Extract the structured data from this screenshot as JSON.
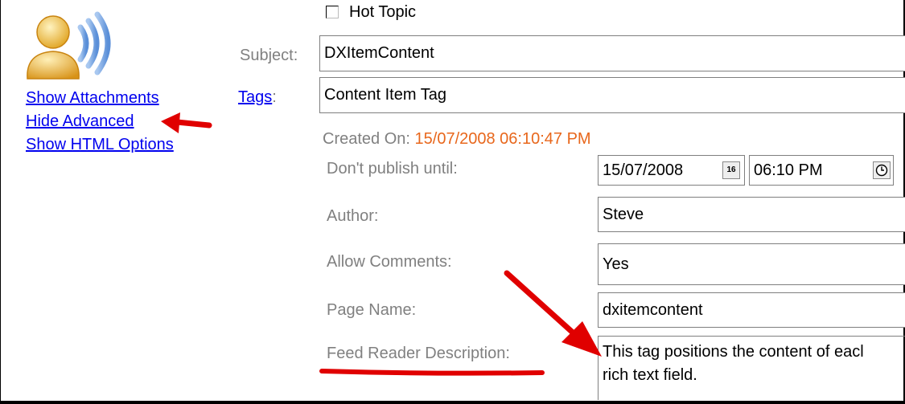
{
  "icons": {
    "avatar": "user-broadcast-icon",
    "calendar": "calendar-icon",
    "clock": "clock-icon"
  },
  "colors": {
    "link": "#0000ee",
    "label": "#808080",
    "created_value": "#e8671c",
    "annotation": "#e00000"
  },
  "sidebar": {
    "show_attachments": "Show Attachments",
    "hide_advanced": "Hide Advanced",
    "show_html_options": "Show HTML Options"
  },
  "form": {
    "hot_topic_label": "Hot Topic",
    "subject_label": "Subject:",
    "subject_value": "DXItemContent",
    "tags_label": "Tags",
    "tags_colon": ":",
    "tags_value": "Content Item Tag",
    "created_on_label": "Created On:",
    "created_on_value": "15/07/2008 06:10:47 PM",
    "publish_label": "Don't publish until:",
    "publish_date": "15/07/2008",
    "calendar_day": "16",
    "publish_time": "06:10 PM",
    "author_label": "Author:",
    "author_value": "Steve",
    "comments_label": "Allow Comments:",
    "comments_value": "Yes",
    "page_name_label": "Page Name:",
    "page_name_value": "dxitemcontent",
    "feed_label": "Feed Reader Description:",
    "feed_line1": "This tag positions the content of eacl",
    "feed_line2": "rich text field."
  }
}
